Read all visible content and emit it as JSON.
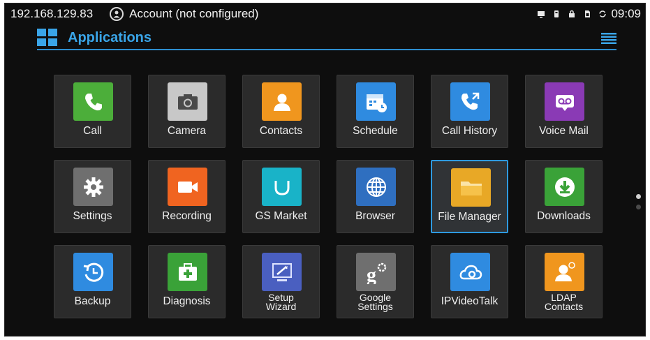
{
  "status_bar": {
    "ip": "192.168.129.83",
    "account": "Account (not configured)",
    "time": "09:09",
    "icons": [
      "screen-icon",
      "usb-icon",
      "lock-icon",
      "sim-icon",
      "sync-icon"
    ]
  },
  "app_bar": {
    "title": "Applications",
    "accent": "#3aa5e8"
  },
  "apps": [
    {
      "label": "Call",
      "icon": "phone-icon",
      "color": "#4cae3a"
    },
    {
      "label": "Camera",
      "icon": "camera-icon",
      "color": "#c8c8c8"
    },
    {
      "label": "Contacts",
      "icon": "contact-icon",
      "color": "#f0961e"
    },
    {
      "label": "Schedule",
      "icon": "calendar-icon",
      "color": "#2f8be0"
    },
    {
      "label": "Call History",
      "icon": "call-history-icon",
      "color": "#2f8be0"
    },
    {
      "label": "Voice Mail",
      "icon": "voicemail-icon",
      "color": "#8a3ab5"
    },
    {
      "label": "Settings",
      "icon": "gear-icon",
      "color": "#6f6f6f"
    },
    {
      "label": "Recording",
      "icon": "video-camera-icon",
      "color": "#f06420"
    },
    {
      "label": "GS Market",
      "icon": "market-icon",
      "color": "#19b3c8"
    },
    {
      "label": "Browser",
      "icon": "globe-icon",
      "color": "#2f6fc0"
    },
    {
      "label": "File Manager",
      "icon": "folder-icon",
      "color": "#e8a826"
    },
    {
      "label": "Downloads",
      "icon": "download-icon",
      "color": "#3aa238"
    },
    {
      "label": "Backup",
      "icon": "backup-icon",
      "color": "#2f8be0"
    },
    {
      "label": "Diagnosis",
      "icon": "first-aid-icon",
      "color": "#3aa238"
    },
    {
      "label": "Setup\nWizard",
      "icon": "wizard-icon",
      "color": "#4a5fc0"
    },
    {
      "label": "Google\nSettings",
      "icon": "google-settings-icon",
      "color": "#6f6f6f"
    },
    {
      "label": "IPVideoTalk",
      "icon": "cloud-camera-icon",
      "color": "#2f8be0"
    },
    {
      "label": "LDAP\nContacts",
      "icon": "ldap-contact-icon",
      "color": "#f0961e"
    }
  ],
  "selected_app": "File Manager",
  "pager": {
    "pages": 2,
    "current": 1
  }
}
